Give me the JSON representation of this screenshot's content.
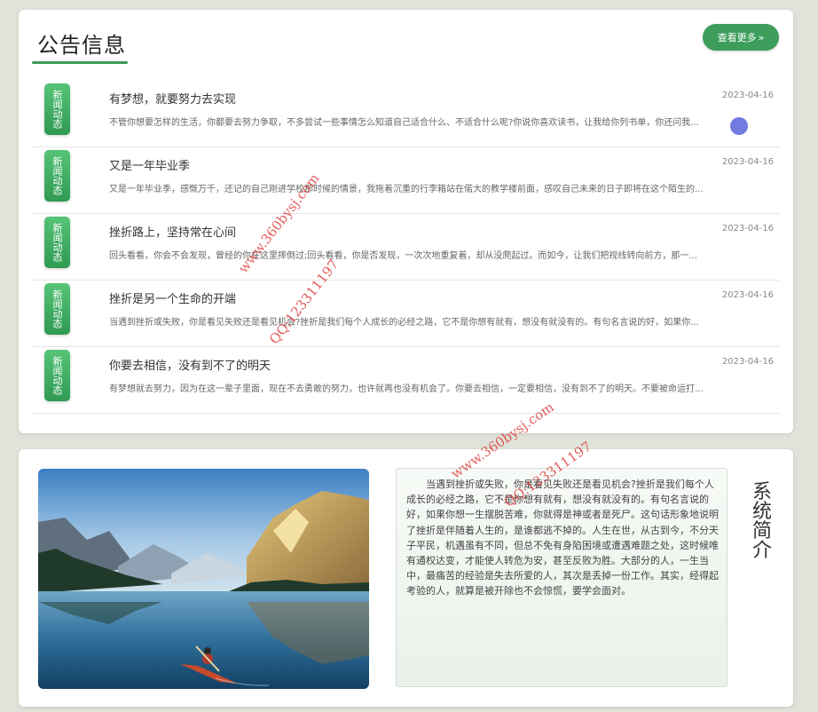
{
  "notice": {
    "title": "公告信息",
    "more_label": "查看更多",
    "more_icon": "double-chevron-right-icon",
    "items": [
      {
        "badge": "新闻动态",
        "title": "有梦想，就要努力去实现",
        "date": "2023-04-16",
        "excerpt": "不管你想要怎样的生活，你都要去努力争取，不多尝试一些事情怎么知道自己适合什么、不适合什么呢?你说你喜欢读书，让我给你列书单，你还问我..."
      },
      {
        "badge": "新闻动态",
        "title": "又是一年毕业季",
        "date": "2023-04-16",
        "excerpt": "又是一年毕业季，感慨万千，还记的自己刚进学校那时候的情景，我拖着沉重的行李箱站在偌大的教学楼前面，感叹自己未来的日子即将在这个陌生的..."
      },
      {
        "badge": "新闻动态",
        "title": "挫折路上，坚持常在心间",
        "date": "2023-04-16",
        "excerpt": "回头看看，你会不会发现，曾经的你在这里摔倒过;回头看看，你是否发现，一次次地重复着，却从没爬起过。而如今，让我们把视线转向前方，那一..."
      },
      {
        "badge": "新闻动态",
        "title": "挫折是另一个生命的开端",
        "date": "2023-04-16",
        "excerpt": "当遇到挫折或失败，你是看见失败还是看见机会?挫折是我们每个人成长的必经之路，它不是你想有就有，想没有就没有的。有句名言说的好，如果你..."
      },
      {
        "badge": "新闻动态",
        "title": "你要去相信，没有到不了的明天",
        "date": "2023-04-16",
        "excerpt": "有梦想就去努力，因为在这一辈子里面，现在不去勇敢的努力，也许就再也没有机会了。你要去相信，一定要相信，没有到不了的明天。不要被命运打..."
      }
    ]
  },
  "intro": {
    "title": "系统简介",
    "image": "lake-mountain-kayak-image",
    "text": "当遇到挫折或失败，你是看见失败还是看见机会?挫折是我们每个人成长的必经之路，它不是你想有就有，想没有就没有的。有句名言说的好，如果你想一生摆脱苦难，你就得是神或者是死尸。这句话形象地说明了挫折是伴随着人生的，是谁都逃不掉的。人生在世，从古到今，不分天子平民，机遇虽有不同，但总不免有身陷困境或遭遇难题之处，这时候唯有通权达变，才能使人转危为安，甚至反败为胜。大部分的人，一生当中，最痛苦的经验是失去所爱的人，其次是丢掉一份工作。其实，经得起考验的人，就算是被开除也不会惊慌，要学会面对。"
  },
  "watermarks": [
    "www.360bysj.com",
    "QQ:123311197",
    "www.360bysj.com",
    "QQ:123311197"
  ],
  "colors": {
    "accent": "#3d9e5b",
    "badge_top": "#56c477",
    "badge_bottom": "#2f9a52",
    "watermark": "#dc2828"
  }
}
